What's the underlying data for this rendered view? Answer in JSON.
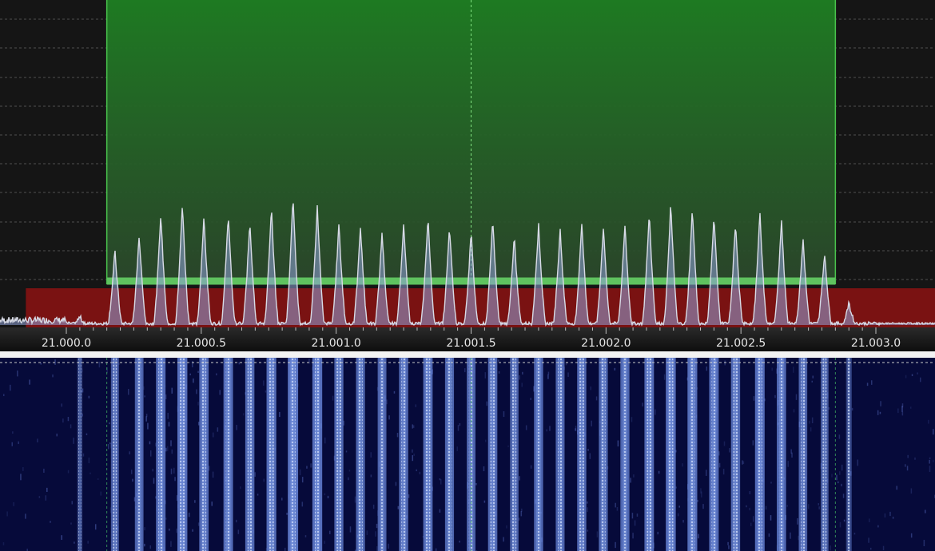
{
  "frequency_axis": {
    "unit": "MHz",
    "range": [
      21.0,
      21.003
    ],
    "ticks": [
      "21.000.0",
      "21.000.5",
      "21.001.0",
      "21.001.5",
      "21.002.0",
      "21.002.5",
      "21.003.0"
    ],
    "tick_values": [
      21.0,
      21.0005,
      21.001,
      21.0015,
      21.002,
      21.0025,
      21.003
    ]
  },
  "selection": {
    "start": 21.00015,
    "end": 21.00285,
    "center": 21.0015,
    "color": "#1e7a22",
    "edge_color": "#49c44d"
  },
  "squelch_band": {
    "start": 20.99985,
    "end": 21.003,
    "color": "#7a1212"
  },
  "spectrum": {
    "trace_color": "#d8dbe6",
    "fill_color": "#8fa2d8",
    "grid": true,
    "carrier_frequencies": [
      21.00005,
      21.00018,
      21.00027,
      21.00035,
      21.00043,
      21.00051,
      21.0006,
      21.00068,
      21.00076,
      21.00084,
      21.00093,
      21.00101,
      21.00109,
      21.00117,
      21.00125,
      21.00134,
      21.00142,
      21.0015,
      21.00158,
      21.00166,
      21.00175,
      21.00183,
      21.00191,
      21.00199,
      21.00207,
      21.00216,
      21.00224,
      21.00232,
      21.0024,
      21.00248,
      21.00257,
      21.00265,
      21.00273,
      21.00281,
      21.0029
    ],
    "carrier_levels": [
      0.03,
      0.28,
      0.34,
      0.42,
      0.46,
      0.41,
      0.42,
      0.39,
      0.44,
      0.49,
      0.45,
      0.38,
      0.37,
      0.35,
      0.39,
      0.41,
      0.37,
      0.35,
      0.4,
      0.33,
      0.38,
      0.36,
      0.39,
      0.37,
      0.38,
      0.42,
      0.46,
      0.44,
      0.42,
      0.39,
      0.43,
      0.4,
      0.33,
      0.27,
      0.08
    ]
  },
  "waterfall": {
    "background": "#060a3a",
    "line_color": "#6f8fe6"
  }
}
